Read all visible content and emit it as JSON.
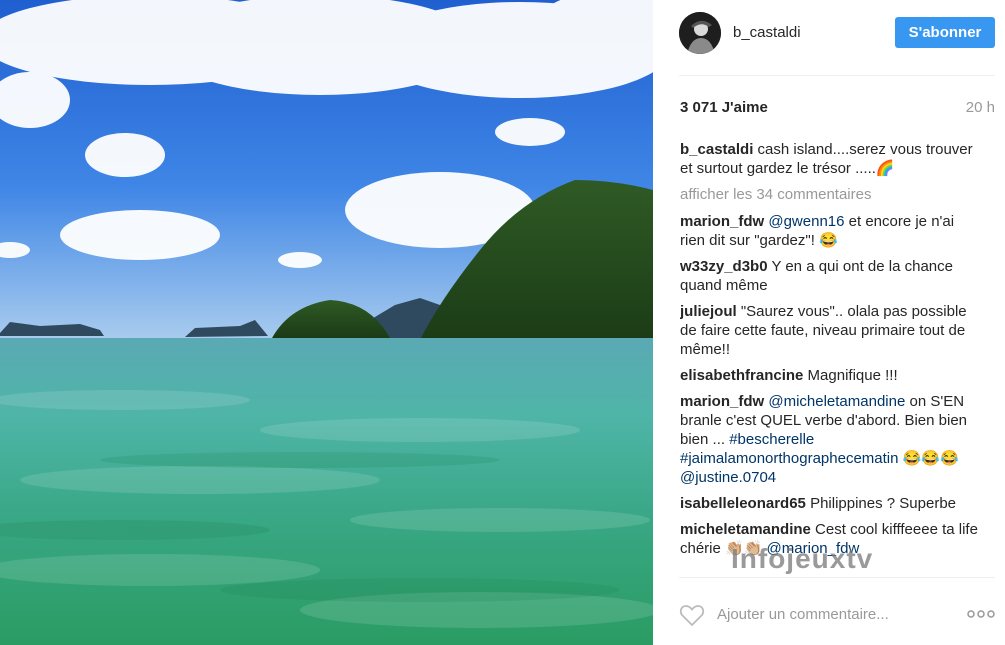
{
  "post": {
    "username": "b_castaldi",
    "follow_label": "S'abonner",
    "likes": "3 071 J'aime",
    "time": "20 h",
    "view_all": "afficher les 34 commentaires",
    "add_comment_placeholder": "Ajouter un commentaire..."
  },
  "caption": {
    "user": "b_castaldi",
    "text": " cash island....serez vous trouver et surtout gardez le trésor .....🌈"
  },
  "comments": [
    {
      "user": "marion_fdw",
      "mention": " @gwenn16",
      "text": " et encore je n'ai rien dit sur \"gardez\"! 😂"
    },
    {
      "user": "w33zy_d3b0",
      "text": " Y en a qui ont de la chance quand même"
    },
    {
      "user": "juliejoul",
      "text": " \"Saurez vous\".. olala pas possible de faire cette faute, niveau primaire tout de même!!"
    },
    {
      "user": "elisabethfrancine",
      "text": " Magnifique !!!"
    },
    {
      "user": "marion_fdw",
      "mention": " @micheletamandine",
      "text": " on S'EN branle c'est QUEL verbe d'abord. Bien bien bien ... ",
      "tags": "#bescherelle #jaimalamonorthographecematin",
      "tail": " 😂😂😂 ",
      "mention2": "@justine.0704"
    },
    {
      "user": "isabelleleonard65",
      "text": " Philippines ? Superbe"
    },
    {
      "user": "micheletamandine",
      "text": " Cest cool kifffeeee ta life chérie 👏🏼👏🏼 ",
      "mention": "@marion_fdw"
    }
  ],
  "watermark": "Infojeuxtv",
  "icons": {
    "heart": "heart-outline-icon",
    "more": "more-dots-icon",
    "avatar": "profile-avatar"
  },
  "colors": {
    "follow_button": "#3897f0",
    "mention": "#003569",
    "muted": "#999999"
  }
}
